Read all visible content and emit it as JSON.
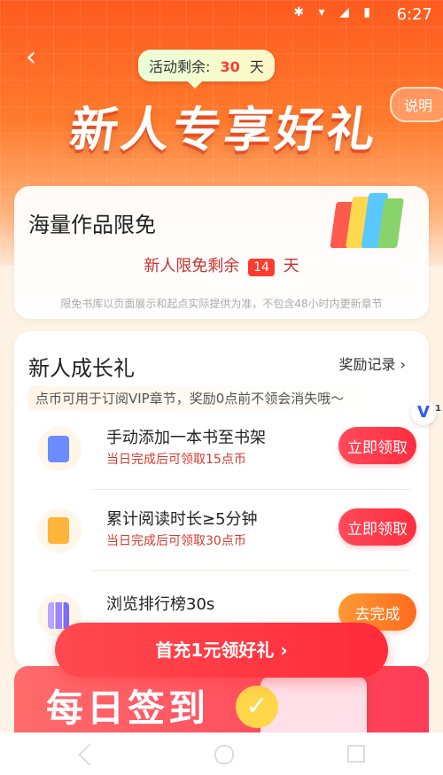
{
  "status": {
    "time": "6:27"
  },
  "header": {
    "back_icon": "chevron-left-icon",
    "remaining_label": "活动剩余:",
    "remaining_days": "30",
    "remaining_unit": "天",
    "title": "新人专享好礼",
    "explain": "说明"
  },
  "free_works": {
    "title": "海量作品限免",
    "remain_prefix": "新人限免剩余",
    "remain_days": "14",
    "remain_unit": "天",
    "note": "限免书库以页面展示和起点实际提供为准，不包含48小时内更新章节"
  },
  "growth": {
    "title": "新人成长礼",
    "record": "奖励记录",
    "hint": "点币可用于订阅VIP章节，奖励0点前不领会消失哦～",
    "tasks": [
      {
        "name": "手动添加一本书至书架",
        "desc": "当日完成后可领取15点币",
        "button": "立即领取",
        "icon": "book-icon"
      },
      {
        "name": "累计阅读时长≥5分钟",
        "desc": "当日完成后可领取30点币",
        "button": "立即领取",
        "icon": "reading-icon"
      },
      {
        "name": "浏览排行榜30s",
        "desc": "",
        "button": "去完成",
        "icon": "ranking-icon"
      }
    ]
  },
  "first_charge": "首充1元领好礼",
  "daily": {
    "title": "每日签到"
  },
  "badge": {
    "letter": "V",
    "count": "1"
  },
  "colors": {
    "accent_red": "#ff2d3f",
    "accent_orange": "#ff6b1f"
  }
}
